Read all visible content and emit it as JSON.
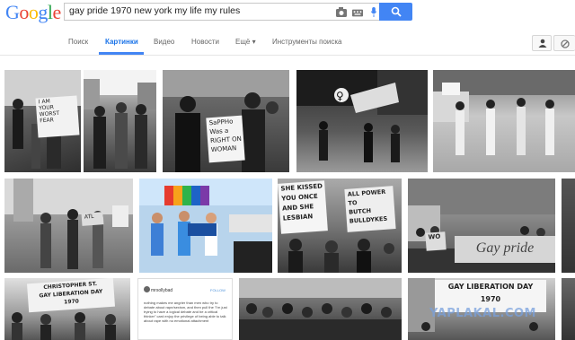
{
  "logo": {
    "letters": [
      {
        "ch": "G",
        "color": "#4285f4"
      },
      {
        "ch": "o",
        "color": "#ea4335"
      },
      {
        "ch": "o",
        "color": "#fbbc05"
      },
      {
        "ch": "g",
        "color": "#4285f4"
      },
      {
        "ch": "l",
        "color": "#34a853"
      },
      {
        "ch": "e",
        "color": "#ea4335"
      }
    ]
  },
  "search": {
    "query": "gay pride 1970 new york my life my rules"
  },
  "tabs": [
    {
      "label": "Поиск"
    },
    {
      "label": "Картинки"
    },
    {
      "label": "Видео"
    },
    {
      "label": "Новости"
    },
    {
      "label": "Ещё ▾"
    },
    {
      "label": "Инструменты поиска"
    }
  ],
  "active_tab_index": 1,
  "signs": {
    "t1": "I AM\nYOUR\nWORST\nFEAR",
    "t3": "SaPPHo\nWas a\nRIGHT ON\nWOMAN",
    "t5": "CHRISTOPHER ST.\nGAY LIBERATION DAY\n1970",
    "t6": "SHE KISSED\nYOU ONCE\nAND SHE\nLESBIAN",
    "t7": "ALL POWER\nTO\nBUTCH\nBULLDYKES",
    "t8": "Gay pride",
    "t9": "GAY LIBERATION DAY\n1970",
    "t10": "WO"
  },
  "post_card": {
    "username": "mrsollybad",
    "follow": "FOLLOW",
    "text": "nothing makes me angrier than men who try to debate about rape/sexism, and then pull the \"i'm just trying to have a logical debate and be a critical thinker\" card  enjoy the privilege of being able to talk about rape with no emotional attachment"
  },
  "watermark": "YAPLAKAL.COM",
  "accent": "#4285f4"
}
